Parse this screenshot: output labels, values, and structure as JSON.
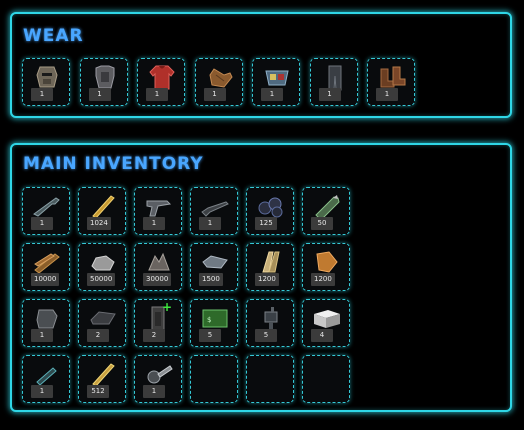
{
  "wear": {
    "title": "WEAR",
    "items": [
      {
        "name": "metal-facemask",
        "qty": "1",
        "icon": "mask-icon"
      },
      {
        "name": "metal-chestplate",
        "qty": "1",
        "icon": "chestplate-icon"
      },
      {
        "name": "hoodie",
        "qty": "1",
        "icon": "hoodie-icon"
      },
      {
        "name": "gloves",
        "qty": "1",
        "icon": "gloves-icon"
      },
      {
        "name": "road-sign-kilt",
        "qty": "1",
        "icon": "kilt-icon"
      },
      {
        "name": "pants",
        "qty": "1",
        "icon": "pants-icon"
      },
      {
        "name": "boots",
        "qty": "1",
        "icon": "boots-icon"
      }
    ]
  },
  "inventory": {
    "title": "MAIN INVENTORY",
    "rows": [
      [
        {
          "name": "rifle",
          "qty": "1",
          "icon": "rifle-icon"
        },
        {
          "name": "ammo-rifle",
          "qty": "1024",
          "icon": "ammo-icon"
        },
        {
          "name": "pistol",
          "qty": "1",
          "icon": "pistol-icon"
        },
        {
          "name": "shotgun",
          "qty": "1",
          "icon": "shotgun-icon"
        },
        {
          "name": "grenades",
          "qty": "125",
          "icon": "grenade-icon"
        },
        {
          "name": "rocket",
          "qty": "50",
          "icon": "rocket-icon"
        }
      ],
      [
        {
          "name": "wood",
          "qty": "10000",
          "icon": "wood-icon"
        },
        {
          "name": "stones",
          "qty": "50000",
          "icon": "stones-icon"
        },
        {
          "name": "metal-fragments",
          "qty": "30000",
          "icon": "metal-frags-icon"
        },
        {
          "name": "high-quality-metal",
          "qty": "1500",
          "icon": "hq-metal-icon"
        },
        {
          "name": "cloth",
          "qty": "1200",
          "icon": "cloth-icon"
        },
        {
          "name": "leather",
          "qty": "1200",
          "icon": "leather-icon"
        }
      ],
      [
        {
          "name": "building-plan",
          "qty": "1",
          "icon": "plan-icon"
        },
        {
          "name": "sheet-metal",
          "qty": "2",
          "icon": "sheet-icon"
        },
        {
          "name": "door",
          "qty": "2",
          "icon": "door-icon",
          "plus": "+"
        },
        {
          "name": "medkit",
          "qty": "5",
          "icon": "medkit-icon"
        },
        {
          "name": "turret",
          "qty": "5",
          "icon": "turret-icon"
        },
        {
          "name": "box",
          "qty": "4",
          "icon": "box-icon"
        }
      ],
      [
        {
          "name": "syringe",
          "qty": "1",
          "icon": "syringe-icon"
        },
        {
          "name": "bullets",
          "qty": "512",
          "icon": "bullets-icon"
        },
        {
          "name": "chainsaw",
          "qty": "1",
          "icon": "chainsaw-icon"
        },
        {
          "name": "empty",
          "qty": "",
          "icon": ""
        },
        {
          "name": "empty",
          "qty": "",
          "icon": ""
        },
        {
          "name": "empty",
          "qty": "",
          "icon": ""
        }
      ]
    ]
  },
  "colors": {
    "accent": "#2fd6e6",
    "title": "#49a6ff",
    "qty_bg": "#3b3b3b",
    "plus": "#3fe83f"
  }
}
